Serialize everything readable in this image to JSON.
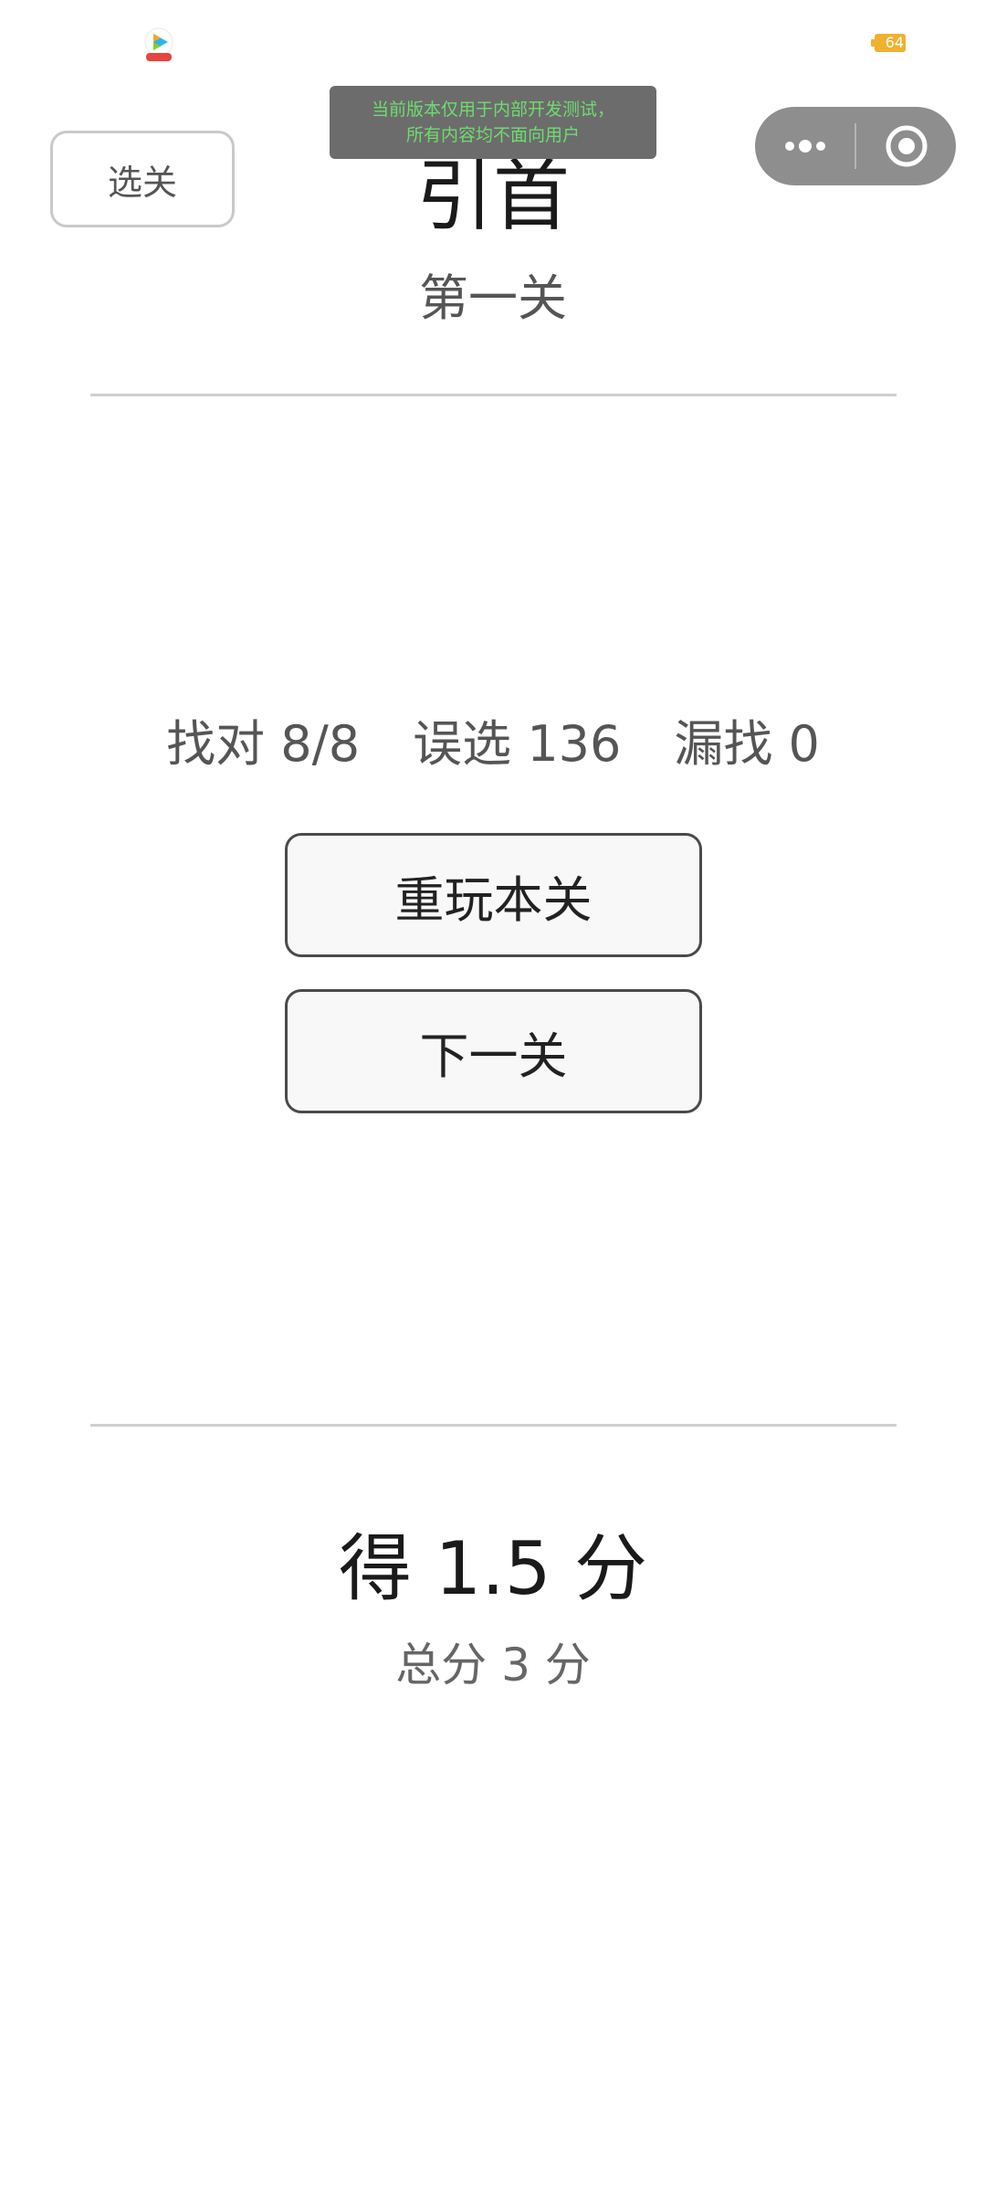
{
  "status_bar": {
    "app_icon": "video-app-icon",
    "battery_level": "64"
  },
  "dev_notice": {
    "line1": "当前版本仅用于内部开发测试，",
    "line2": "所有内容均不面向用户"
  },
  "capsule": {
    "more_icon": "more-dots-icon",
    "close_icon": "target-close-icon"
  },
  "header": {
    "level_select_label": "选关",
    "title": "引首",
    "subtitle": "第一关"
  },
  "stats": {
    "found": "找对 8/8",
    "wrong": "误选 136",
    "missed": "漏找 0"
  },
  "actions": {
    "replay_label": "重玩本关",
    "next_label": "下一关"
  },
  "score": {
    "earned": "得 1.5 分",
    "total": "总分 3 分"
  },
  "colors": {
    "notice_text": "#6edc6e",
    "notice_bg": "#6c6c6c",
    "battery": "#f0b030",
    "capsule_bg": "#8e8e8e"
  }
}
